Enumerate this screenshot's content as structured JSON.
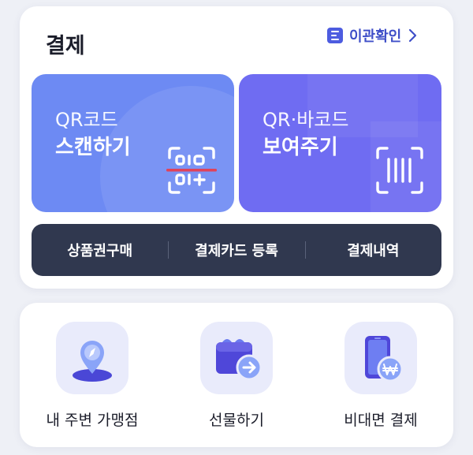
{
  "payment": {
    "title": "결제",
    "transfer_link": "이관확인",
    "scan_tile": {
      "sub": "QR코드",
      "main": "스캔하기"
    },
    "show_tile": {
      "sub": "QR·바코드",
      "main": "보여주기"
    },
    "actions": [
      "상품권구매",
      "결제카드 등록",
      "결제내역"
    ]
  },
  "menu": [
    {
      "label": "내 주변 가맹점",
      "icon": "location-pin-icon"
    },
    {
      "label": "선물하기",
      "icon": "gift-card-icon"
    },
    {
      "label": "비대면 결제",
      "icon": "phone-won-icon"
    }
  ],
  "colors": {
    "scan_tile": "#6d8af3",
    "show_tile": "#6f6cf2",
    "action_bar": "#30384f",
    "accent": "#4d5ce0",
    "icon_bg": "#e9ebfb"
  }
}
